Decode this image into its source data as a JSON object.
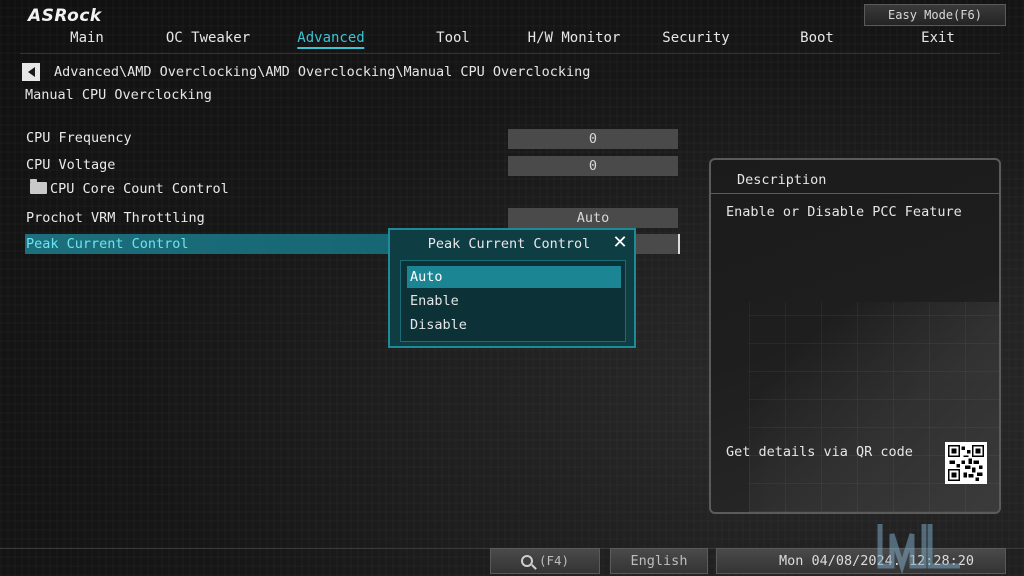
{
  "brand": "ASRock",
  "easy_mode_label": "Easy Mode(F6)",
  "menu": {
    "tabs": [
      {
        "label": "Main"
      },
      {
        "label": "OC Tweaker"
      },
      {
        "label": "Advanced",
        "active": true
      },
      {
        "label": "Tool"
      },
      {
        "label": "H/W Monitor"
      },
      {
        "label": "Security"
      },
      {
        "label": "Boot"
      },
      {
        "label": "Exit"
      }
    ]
  },
  "breadcrumb": "Advanced\\AMD Overclocking\\AMD Overclocking\\Manual CPU Overclocking",
  "page_title": "Manual CPU Overclocking",
  "settings": [
    {
      "label": "CPU Frequency",
      "value": "0"
    },
    {
      "label": "CPU Voltage",
      "value": "0"
    },
    {
      "label": "CPU Core Count Control",
      "value": ""
    },
    {
      "label": "Prochot VRM Throttling",
      "value": "Auto"
    },
    {
      "label": "Peak Current Control",
      "value": "Auto"
    }
  ],
  "popup": {
    "title": "Peak Current Control",
    "close_icon": "close-icon",
    "options": [
      "Auto",
      "Enable",
      "Disable"
    ],
    "selected": "Auto"
  },
  "description": {
    "header": "Description",
    "text": "Enable or Disable PCC Feature",
    "qr_label": "Get details via QR code"
  },
  "footer": {
    "search_label": "(F4)",
    "language": "English",
    "datetime": "Mon 04/08/2024. 12:28:20"
  },
  "colors": {
    "accent": "#3cc3d4",
    "highlight": "#1c6f7c",
    "popup_bg": "#0f3d44"
  }
}
